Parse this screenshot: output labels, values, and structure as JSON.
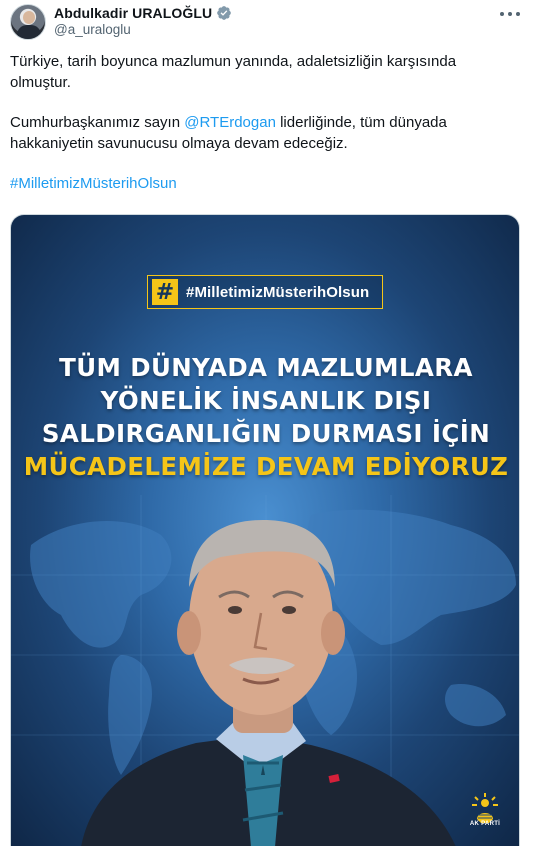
{
  "author": {
    "display_name": "Abdulkadir URALOĞLU",
    "handle": "@a_uraloglu",
    "verified_icon": "verified-badge-icon"
  },
  "tweet": {
    "paragraph1": "Türkiye, tarih boyunca mazlumun yanında, adaletsizliğin karşısında olmuştur.",
    "paragraph2_before": "Cumhurbaşkanımız sayın ",
    "mention": "@RTErdogan",
    "paragraph2_after": " liderliğinde, tüm dünyada hakkaniyetin savunucusu olmaya devam edeceğiz.",
    "hashtag": "#MilletimizMüsterihOlsun"
  },
  "media": {
    "tag_symbol": "#",
    "tag_text": "#MilletimizMüsterihOlsun",
    "headline_line1": "TÜM DÜNYADA MAZLUMLARA",
    "headline_line2": "YÖNELİK İNSANLIK DIŞI",
    "headline_line3": "SALDIRGANLIĞIN DURMASI İÇİN",
    "headline_line4": "MÜCADELEMİZE DEVAM EDİYORUZ",
    "logo_label": "AK PARTİ"
  },
  "colors": {
    "accent": "#1d9bf0",
    "highlight_yellow": "#f5c518",
    "poster_blue": "#2f6aa8"
  }
}
